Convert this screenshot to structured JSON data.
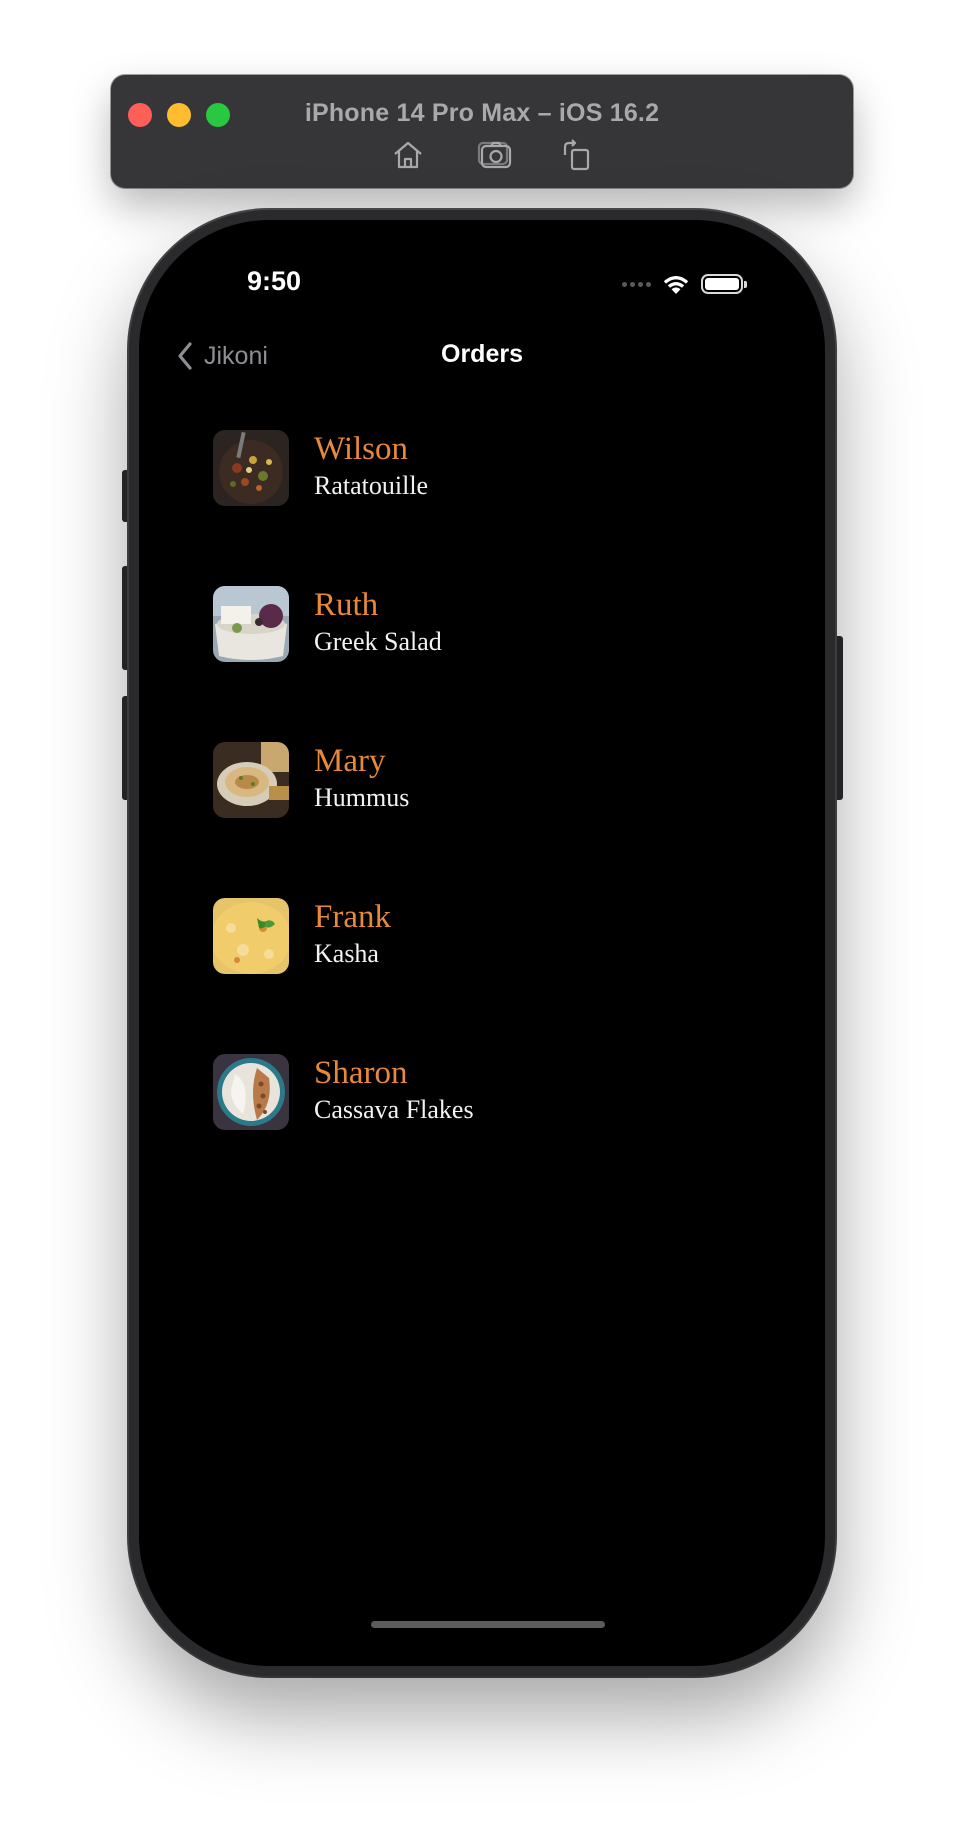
{
  "simulator": {
    "title": "iPhone 14 Pro Max – iOS 16.2",
    "toolbar": {
      "home_icon": "home-icon",
      "screenshot_icon": "screenshot-icon",
      "rotate_icon": "rotate-icon"
    }
  },
  "status_bar": {
    "time": "9:50"
  },
  "nav": {
    "back_label": "Jikoni",
    "title": "Orders"
  },
  "orders": [
    {
      "customer": "Wilson",
      "dish": "Ratatouille"
    },
    {
      "customer": "Ruth",
      "dish": "Greek Salad"
    },
    {
      "customer": "Mary",
      "dish": "Hummus"
    },
    {
      "customer": "Frank",
      "dish": "Kasha"
    },
    {
      "customer": "Sharon",
      "dish": "Cassava Flakes"
    }
  ],
  "colors": {
    "accent": "#e8893a",
    "background": "#000000",
    "text": "#f2f2f2",
    "secondary": "#8e8e93"
  }
}
